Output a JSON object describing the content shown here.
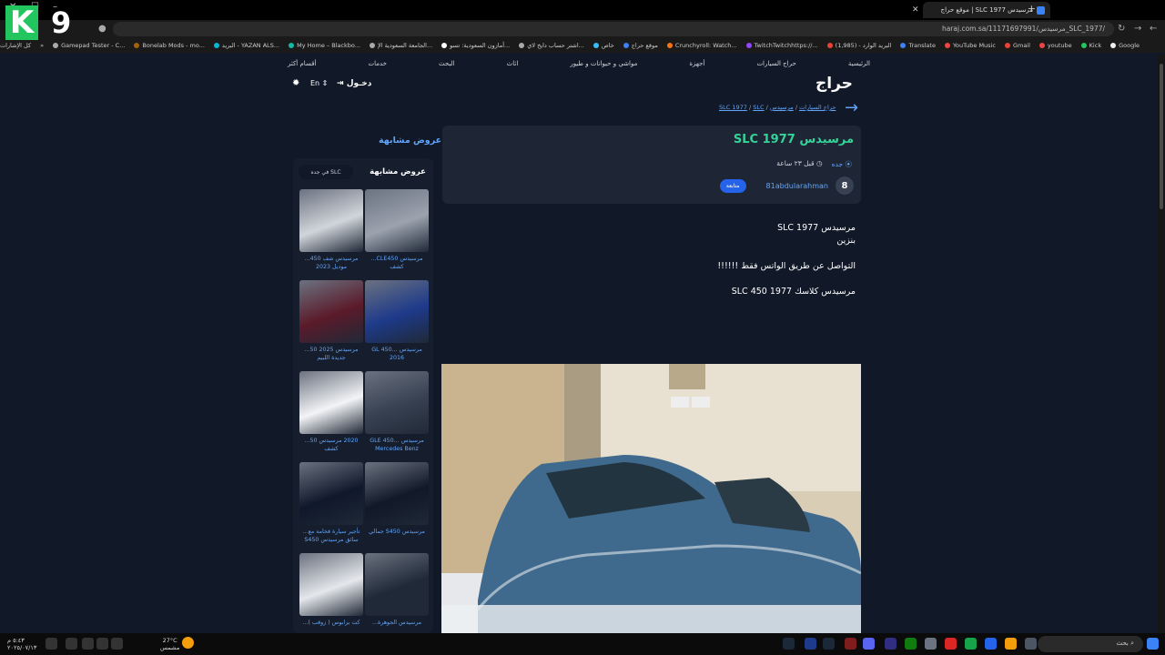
{
  "browser": {
    "tab_title": "مرسيدس SLC 1977 | موقع حراج",
    "url": "haraj.com.sa/11171697991/مرسيدس_SLC_1977/",
    "bookmarks": [
      "Google",
      "Kick",
      "youtube",
      "Gmail",
      "YouTube Music",
      "Translate",
      "البريد الوارد - (1,985)",
      "TwitchTwitchhttps://...",
      "Crunchyroll: Watch...",
      "موقع حراج",
      "خاص",
      "اشتر حساب دايخ لاي...",
      "أمازون السعودية: تسو...",
      "الجامعة السعودية الإ...",
      "My Home – Blackbo...",
      "البريد - YAZAN ALS...",
      "Bonelab Mods - mo...",
      "Gamepad Tester - C..."
    ],
    "bookmarks_folder": "كل الإشارات المرجعية"
  },
  "overlay": {
    "k": "K",
    "n": "9"
  },
  "site": {
    "logo": "حراج",
    "nav": [
      "الرئيسية",
      "حراج السيارات",
      "أجهزة",
      "مواشي و حيوانات و طيور",
      "اثاث",
      "البحث",
      "خدمات",
      "أقسام أكثر"
    ],
    "login": "دخـول",
    "lang": "En"
  },
  "breadcrumb": {
    "a": "حراج السيارات",
    "b": "مرسيدس",
    "c": "SLC 1977",
    "d": "SLC",
    "sep": "/"
  },
  "post": {
    "title": "مرسيدس SLC 1977",
    "city": "جده",
    "time": "قبل ٢٣ ساعة",
    "author_initial": "8",
    "author": "81abdularahman",
    "follow": "متابعة",
    "body": [
      "مرسيدس SLC 1977",
      "بنزين",
      "التواصل عن طريق الواتس فقط !!!!!!",
      "مرسيدس كلاسك 1977 SLC 450"
    ]
  },
  "similar": {
    "heading": "عروض مشابهة",
    "panel_title": "عروض مشابهة",
    "filter": "SLC في جده",
    "items": [
      {
        "caption": "مرسيدس CLE450... كشف",
        "color": "#9ca3af"
      },
      {
        "caption": "مرسيدس شف 450... موديل 2023",
        "color": "#d1d5db"
      },
      {
        "caption": "مرسيدس GL 450... 2016",
        "color": "#1e3a8a"
      },
      {
        "caption": "مرسيدس 2025 50... جديدة اللبيم",
        "color": "#5b1a2a"
      },
      {
        "caption": "مرسيدس GLE 450... Mercedes Benz",
        "color": "#374151"
      },
      {
        "caption": "2020 مرسيدس 50... كشف",
        "color": "#f3f4f6"
      },
      {
        "caption": "مرسيدس S450 جمالي",
        "color": "#111827"
      },
      {
        "caption": "تأجير سيارة فخامة مع... سائق مرسيدس S450",
        "color": "#0f172a"
      },
      {
        "caption": "مرسيدس الجوهرة...",
        "color": "#1f2937"
      },
      {
        "caption": "كت برابوس ( زوقب )...",
        "color": "#e5e7eb"
      }
    ]
  },
  "taskbar": {
    "search": "بحث",
    "weather_temp": "27°C",
    "weather_desc": "مشمس",
    "time": "٥:٤٣ م",
    "date": "٢٠٢٥/٠٧/١٣"
  }
}
